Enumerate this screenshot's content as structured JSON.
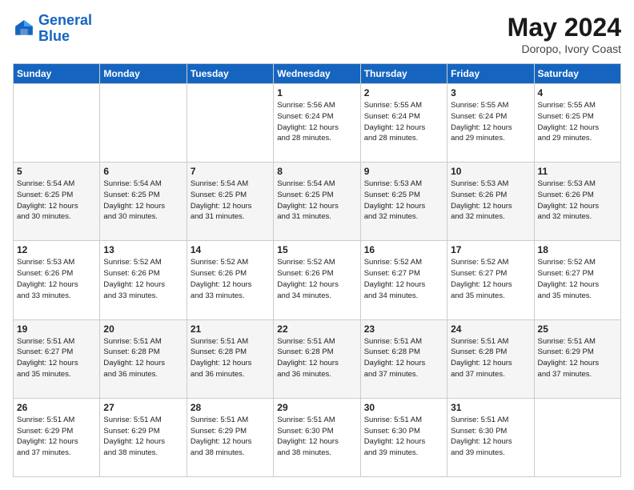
{
  "logo": {
    "line1": "General",
    "line2": "Blue"
  },
  "title": {
    "month_year": "May 2024",
    "location": "Doropo, Ivory Coast"
  },
  "headers": [
    "Sunday",
    "Monday",
    "Tuesday",
    "Wednesday",
    "Thursday",
    "Friday",
    "Saturday"
  ],
  "weeks": [
    [
      {
        "day": "",
        "info": ""
      },
      {
        "day": "",
        "info": ""
      },
      {
        "day": "",
        "info": ""
      },
      {
        "day": "1",
        "info": "Sunrise: 5:56 AM\nSunset: 6:24 PM\nDaylight: 12 hours\nand 28 minutes."
      },
      {
        "day": "2",
        "info": "Sunrise: 5:55 AM\nSunset: 6:24 PM\nDaylight: 12 hours\nand 28 minutes."
      },
      {
        "day": "3",
        "info": "Sunrise: 5:55 AM\nSunset: 6:24 PM\nDaylight: 12 hours\nand 29 minutes."
      },
      {
        "day": "4",
        "info": "Sunrise: 5:55 AM\nSunset: 6:25 PM\nDaylight: 12 hours\nand 29 minutes."
      }
    ],
    [
      {
        "day": "5",
        "info": "Sunrise: 5:54 AM\nSunset: 6:25 PM\nDaylight: 12 hours\nand 30 minutes."
      },
      {
        "day": "6",
        "info": "Sunrise: 5:54 AM\nSunset: 6:25 PM\nDaylight: 12 hours\nand 30 minutes."
      },
      {
        "day": "7",
        "info": "Sunrise: 5:54 AM\nSunset: 6:25 PM\nDaylight: 12 hours\nand 31 minutes."
      },
      {
        "day": "8",
        "info": "Sunrise: 5:54 AM\nSunset: 6:25 PM\nDaylight: 12 hours\nand 31 minutes."
      },
      {
        "day": "9",
        "info": "Sunrise: 5:53 AM\nSunset: 6:25 PM\nDaylight: 12 hours\nand 32 minutes."
      },
      {
        "day": "10",
        "info": "Sunrise: 5:53 AM\nSunset: 6:26 PM\nDaylight: 12 hours\nand 32 minutes."
      },
      {
        "day": "11",
        "info": "Sunrise: 5:53 AM\nSunset: 6:26 PM\nDaylight: 12 hours\nand 32 minutes."
      }
    ],
    [
      {
        "day": "12",
        "info": "Sunrise: 5:53 AM\nSunset: 6:26 PM\nDaylight: 12 hours\nand 33 minutes."
      },
      {
        "day": "13",
        "info": "Sunrise: 5:52 AM\nSunset: 6:26 PM\nDaylight: 12 hours\nand 33 minutes."
      },
      {
        "day": "14",
        "info": "Sunrise: 5:52 AM\nSunset: 6:26 PM\nDaylight: 12 hours\nand 33 minutes."
      },
      {
        "day": "15",
        "info": "Sunrise: 5:52 AM\nSunset: 6:26 PM\nDaylight: 12 hours\nand 34 minutes."
      },
      {
        "day": "16",
        "info": "Sunrise: 5:52 AM\nSunset: 6:27 PM\nDaylight: 12 hours\nand 34 minutes."
      },
      {
        "day": "17",
        "info": "Sunrise: 5:52 AM\nSunset: 6:27 PM\nDaylight: 12 hours\nand 35 minutes."
      },
      {
        "day": "18",
        "info": "Sunrise: 5:52 AM\nSunset: 6:27 PM\nDaylight: 12 hours\nand 35 minutes."
      }
    ],
    [
      {
        "day": "19",
        "info": "Sunrise: 5:51 AM\nSunset: 6:27 PM\nDaylight: 12 hours\nand 35 minutes."
      },
      {
        "day": "20",
        "info": "Sunrise: 5:51 AM\nSunset: 6:28 PM\nDaylight: 12 hours\nand 36 minutes."
      },
      {
        "day": "21",
        "info": "Sunrise: 5:51 AM\nSunset: 6:28 PM\nDaylight: 12 hours\nand 36 minutes."
      },
      {
        "day": "22",
        "info": "Sunrise: 5:51 AM\nSunset: 6:28 PM\nDaylight: 12 hours\nand 36 minutes."
      },
      {
        "day": "23",
        "info": "Sunrise: 5:51 AM\nSunset: 6:28 PM\nDaylight: 12 hours\nand 37 minutes."
      },
      {
        "day": "24",
        "info": "Sunrise: 5:51 AM\nSunset: 6:28 PM\nDaylight: 12 hours\nand 37 minutes."
      },
      {
        "day": "25",
        "info": "Sunrise: 5:51 AM\nSunset: 6:29 PM\nDaylight: 12 hours\nand 37 minutes."
      }
    ],
    [
      {
        "day": "26",
        "info": "Sunrise: 5:51 AM\nSunset: 6:29 PM\nDaylight: 12 hours\nand 37 minutes."
      },
      {
        "day": "27",
        "info": "Sunrise: 5:51 AM\nSunset: 6:29 PM\nDaylight: 12 hours\nand 38 minutes."
      },
      {
        "day": "28",
        "info": "Sunrise: 5:51 AM\nSunset: 6:29 PM\nDaylight: 12 hours\nand 38 minutes."
      },
      {
        "day": "29",
        "info": "Sunrise: 5:51 AM\nSunset: 6:30 PM\nDaylight: 12 hours\nand 38 minutes."
      },
      {
        "day": "30",
        "info": "Sunrise: 5:51 AM\nSunset: 6:30 PM\nDaylight: 12 hours\nand 39 minutes."
      },
      {
        "day": "31",
        "info": "Sunrise: 5:51 AM\nSunset: 6:30 PM\nDaylight: 12 hours\nand 39 minutes."
      },
      {
        "day": "",
        "info": ""
      }
    ]
  ]
}
